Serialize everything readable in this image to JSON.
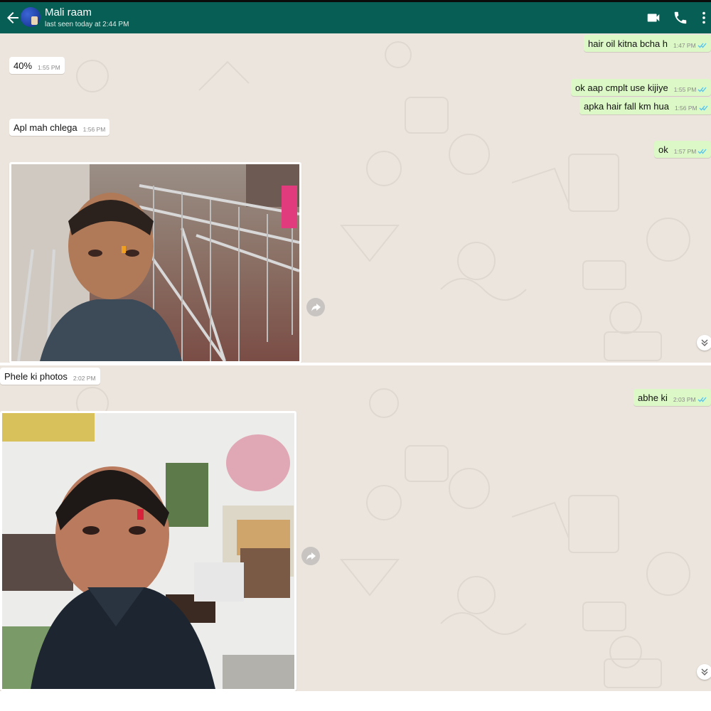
{
  "header": {
    "contact_name": "Mali raam",
    "last_seen": "last seen today at 2:44 PM"
  },
  "messages": [
    {
      "direction": "out",
      "text": "hair oil kitna bcha h",
      "time": "1:47 PM",
      "status": "read"
    },
    {
      "direction": "in",
      "text": "40%",
      "time": "1:55 PM"
    },
    {
      "direction": "out",
      "text": "ok aap cmplt use kijiye",
      "time": "1:55 PM",
      "status": "read"
    },
    {
      "direction": "out",
      "text": "apka hair fall km hua",
      "time": "1:56 PM",
      "status": "read"
    },
    {
      "direction": "in",
      "text": "Apl mah chlega",
      "time": "1:56 PM"
    },
    {
      "direction": "out",
      "text": "ok",
      "time": "1:57 PM",
      "status": "read"
    },
    {
      "direction": "in",
      "type": "image",
      "description": "selfie-at-temple-railings"
    },
    {
      "direction": "in",
      "text": "Phele ki photos",
      "time": "2:02 PM"
    },
    {
      "direction": "out",
      "text": "abhe ki",
      "time": "2:03 PM",
      "status": "read"
    },
    {
      "direction": "in",
      "type": "image",
      "description": "selfie-in-shop"
    }
  ],
  "colors": {
    "header": "#075e54",
    "chat_background": "#ece5dd",
    "outgoing_bubble": "#dcf8c6",
    "incoming_bubble": "#ffffff",
    "read_ticks": "#4fc3f7"
  },
  "icons": {
    "back": "arrow-left",
    "video_call": "video-camera",
    "voice_call": "phone",
    "menu": "more-vertical",
    "forward": "share-arrow",
    "scroll_down": "double-chevron-down"
  }
}
